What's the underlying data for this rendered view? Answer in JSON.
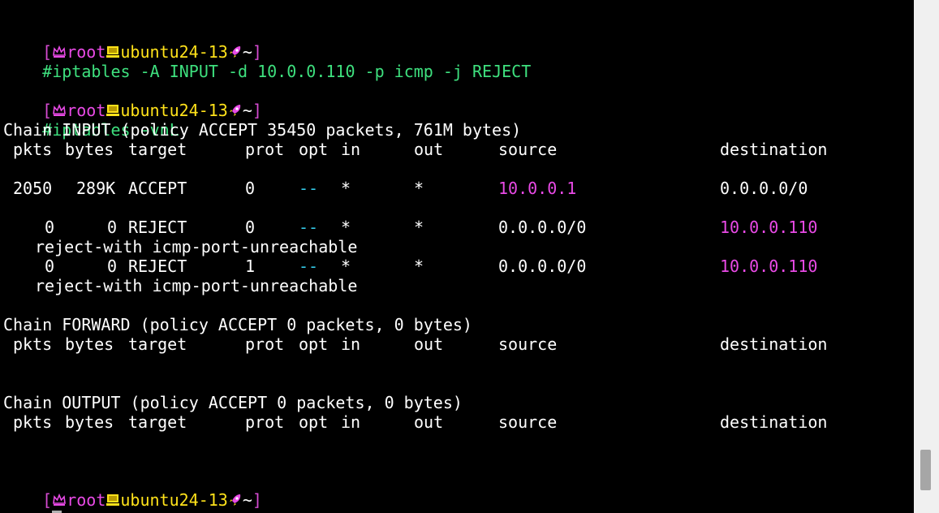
{
  "prompt": {
    "open_bracket": "[",
    "user": "root",
    "host": "ubuntu24-13",
    "path": "~",
    "close_bracket": "]",
    "hash": "#",
    "colors": {
      "bracket": "#d64bd2",
      "user": "#e94ae6",
      "host": "#ffe21a",
      "command": "#3ee07e"
    },
    "icons": [
      "crown-icon",
      "computer-icon",
      "rocket-icon"
    ]
  },
  "commands": [
    "iptables -A INPUT -d 10.0.0.110 -p icmp -j REJECT",
    "iptables -vnL"
  ],
  "columns": {
    "pkts": "pkts",
    "bytes": "bytes",
    "target": "target",
    "prot": "prot",
    "opt": "opt",
    "in": "in",
    "out": "out",
    "source": "source",
    "destination": "destination"
  },
  "chains": {
    "input": {
      "title": "Chain INPUT (policy ACCEPT 35450 packets, 761M bytes)",
      "rules": [
        {
          "pkts": "2050",
          "bytes": "289K",
          "target": "ACCEPT",
          "prot": "0",
          "opt": "--",
          "in": "*",
          "out": "*",
          "source": "10.0.0.1",
          "destination": "0.0.0.0/0"
        },
        {
          "pkts": "0",
          "bytes": "0",
          "target": "REJECT",
          "prot": "0",
          "opt": "--",
          "in": "*",
          "out": "*",
          "source": "0.0.0.0/0",
          "destination": "10.0.0.110",
          "extra": "reject-with icmp-port-unreachable"
        },
        {
          "pkts": "0",
          "bytes": "0",
          "target": "REJECT",
          "prot": "1",
          "opt": "--",
          "in": "*",
          "out": "*",
          "source": "0.0.0.0/0",
          "destination": "10.0.0.110",
          "extra": "reject-with icmp-port-unreachable"
        }
      ]
    },
    "forward": {
      "title": "Chain FORWARD (policy ACCEPT 0 packets, 0 bytes)"
    },
    "output": {
      "title": "Chain OUTPUT (policy ACCEPT 0 packets, 0 bytes)"
    }
  }
}
